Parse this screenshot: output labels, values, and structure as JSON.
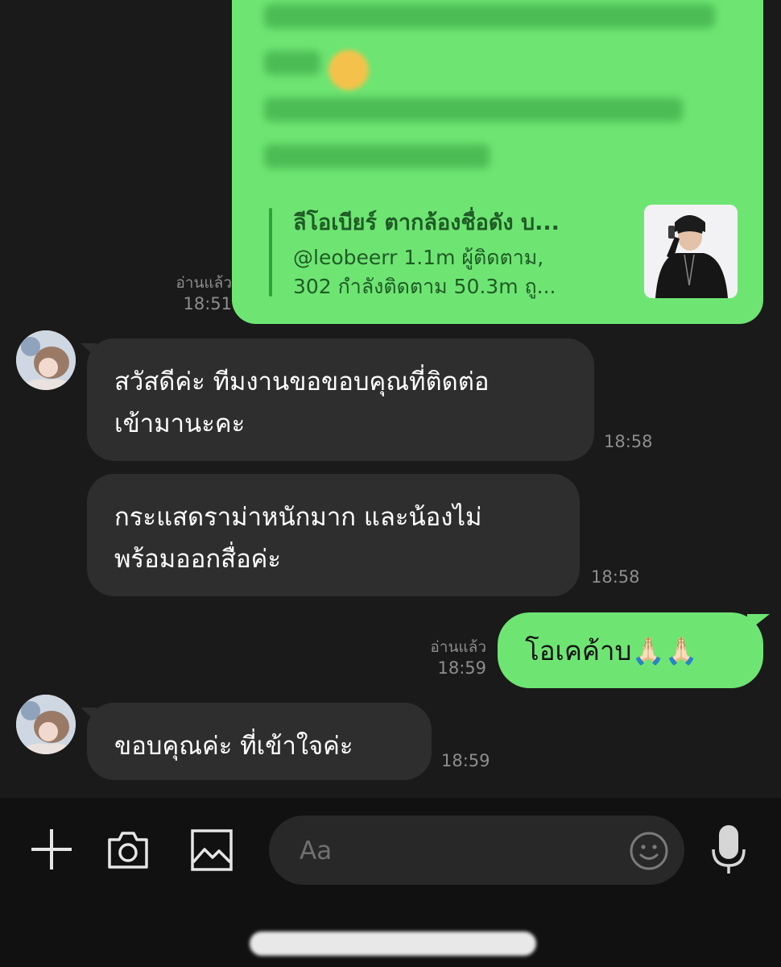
{
  "messages": {
    "link_preview": {
      "title": "ลีโอเบียร์ ตากล้องชื่อดัง บ...",
      "desc_line1": "@leobeerr 1.1m ผู้ติดตาม,",
      "desc_line2": "302 กำลังติดตาม 50.3m ถู..."
    },
    "read_1": "อ่านแล้ว",
    "time_1": "18:51",
    "in_1_line1": "สวัสดีค่ะ ทีมงานขอขอบคุณที่ติดต่อ",
    "in_1_line2": "เข้ามานะคะ",
    "time_2": "18:58",
    "in_2_line1": "กระแสดราม่าหนักมาก และน้องไม่",
    "in_2_line2": "พร้อมออกสื่อค่ะ",
    "time_3": "18:58",
    "read_2": "อ่านแล้ว",
    "time_4": "18:59",
    "out_1": "โอเคค้าบ🙏🏻🙏🏻",
    "in_3": "ขอบคุณค่ะ ที่เข้าใจค่ะ",
    "time_5": "18:59"
  },
  "composer": {
    "placeholder": "Aa",
    "icons": [
      "plus-icon",
      "camera-icon",
      "image-icon",
      "emoji-icon",
      "microphone-icon"
    ]
  },
  "colors": {
    "outgoing_bubble": "#6ee573",
    "incoming_bubble": "#2e2e2e",
    "background": "#1a1a1a"
  }
}
